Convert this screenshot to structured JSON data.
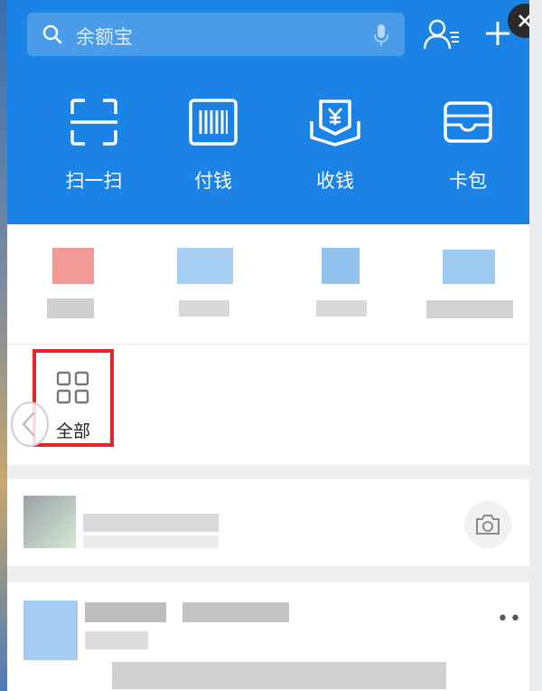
{
  "search": {
    "placeholder": "余额宝"
  },
  "quick_actions": [
    {
      "label": "扫一扫",
      "icon": "scan-icon"
    },
    {
      "label": "付钱",
      "icon": "barcode-icon"
    },
    {
      "label": "收钱",
      "icon": "receive-money-icon"
    },
    {
      "label": "卡包",
      "icon": "card-wallet-icon"
    }
  ],
  "all_apps": {
    "label": "全部",
    "icon": "grid-icon",
    "highlight_color": "#e0262b"
  },
  "colors": {
    "header_blue": "#1b82e6",
    "search_bg": "#4a9ce9"
  }
}
